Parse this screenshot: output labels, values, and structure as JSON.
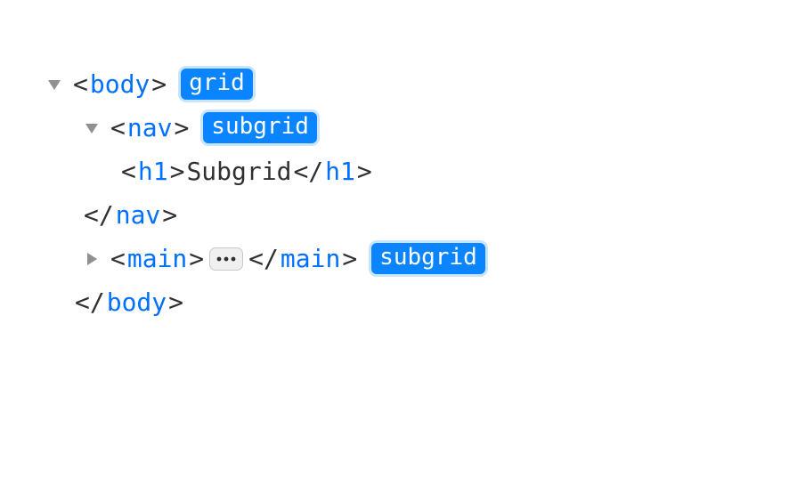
{
  "tree": {
    "body": {
      "open": "body",
      "badge": "grid",
      "close": "body"
    },
    "nav": {
      "open": "nav",
      "badge": "subgrid",
      "close": "nav"
    },
    "h1": {
      "open": "h1",
      "text": "Subgrid",
      "close": "h1"
    },
    "main": {
      "open": "main",
      "close": "main",
      "badge": "subgrid"
    }
  },
  "syntax": {
    "lt": "<",
    "gt": ">",
    "lts": "</"
  }
}
